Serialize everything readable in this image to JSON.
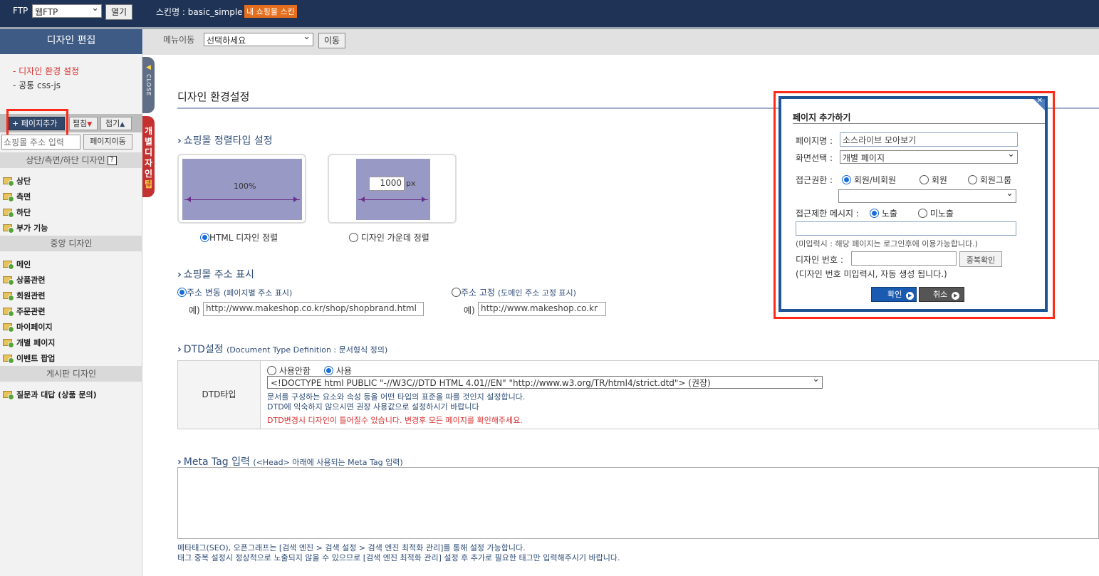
{
  "topbar": {
    "ftp_label": "FTP",
    "ftp_select": "웹FTP",
    "open_button": "열기",
    "skin_label": "스킨명 : basic_simple",
    "my_skin_badge": "내 쇼핑몰 스킨"
  },
  "sidebar": {
    "title": "디자인 편집",
    "links": [
      {
        "label": "- 디자인 환경 설정",
        "active": true
      },
      {
        "label": "- 공통 css-js",
        "active": false
      }
    ],
    "add_page": "+ 페이지추가",
    "expand": "펼침",
    "collapse": "접기",
    "search_placeholder": "쇼핑몰 주소 입력",
    "move_page": "페이지이동",
    "sections": [
      {
        "title": "상단/측면/하단 디자인",
        "help": "?",
        "items": [
          "상단",
          "측면",
          "하단",
          "부가 기능"
        ]
      },
      {
        "title": "중앙 디자인",
        "items": [
          "메인",
          "상품관련",
          "회원관련",
          "주문관련",
          "마이페이지",
          "개별 페이지",
          "이벤트 팝업"
        ]
      },
      {
        "title": "게시판 디자인",
        "items": [
          "질문과 대답 (상품 문의)"
        ]
      }
    ],
    "close_tab": "CLOSE",
    "tip_tab": [
      "개",
      "별",
      "디",
      "자",
      "인"
    ],
    "tip_tab_last": "팁"
  },
  "menubar": {
    "label": "메뉴이동",
    "select": "선택하세요",
    "go_button": "이동"
  },
  "main": {
    "title": "디자인 환경설정",
    "align": {
      "heading": "쇼핑몰 정렬타입 설정",
      "opt1_box": "100%",
      "opt2_value": "1000",
      "opt2_unit": "px",
      "opt1_label": "HTML 디자인 정렬",
      "opt2_label": "디자인 가운데 정렬",
      "selected": 1
    },
    "address": {
      "heading": "쇼핑몰 주소 표시",
      "opt1_label": "주소 변동",
      "opt1_desc": "(페이지별 주소 표시)",
      "opt1_example_label": "예)",
      "opt1_example": "http://www.makeshop.co.kr/shop/shopbrand.html",
      "opt2_label": "주소 고정",
      "opt2_desc": "(도메인 주소 고정 표시)",
      "opt2_example_label": "예)",
      "opt2_example": "http://www.makeshop.co.kr",
      "selected": 1
    },
    "dtd": {
      "heading": "DTD설정",
      "heading_small": "(Document Type Definition : 문서형식 정의)",
      "row_label": "DTD타입",
      "opt_off": "사용안함",
      "opt_on": "사용",
      "selected": "on",
      "select_value": "<!DOCTYPE html PUBLIC \"-//W3C//DTD HTML 4.01//EN\" \"http://www.w3.org/TR/html4/strict.dtd\"> (권장)",
      "desc1": "문서를 구성하는 요소와 속성 등을 어떤 타입의 표준을 따를 것인지 설정합니다.",
      "desc2": "DTD에 익숙하지 않으시면 권장 사용값으로 설정하시기 바랍니다",
      "warning": "DTD변경시 디자인이 틀어질수 있습니다. 변경후 모든 페이지를 확인해주세요."
    },
    "meta": {
      "heading": "Meta Tag 입력",
      "heading_small": "(<Head> 아래에 사용되는 Meta Tag 입력)",
      "note1": "메타태그(SEO), 오픈그래프는 [검색 엔진 > 검색 설정 > 검색 엔진 최적화 관리]를 통해 설정 가능합니다.",
      "note2": "태그 중복 설정시 정상적으로 노출되지 않을 수 있으므로 [검색 엔진 최적화 관리] 설정 후 추가로 필요한 태그만 입력해주시기 바랍니다."
    }
  },
  "modal": {
    "title": "페이지 추가하기",
    "page_name_label": "페이지명 :",
    "page_name_value": "소스라이브 모아보기",
    "screen_label": "화면선택 :",
    "screen_value": "개별 페이지",
    "access_label": "접근권한 :",
    "access_opts": [
      "회원/비회원",
      "회원",
      "회원그룹"
    ],
    "access_selected": 0,
    "group_select": "",
    "restrict_label": "접근제한 메시지 :",
    "restrict_opts": [
      "노출",
      "미노출"
    ],
    "restrict_selected": 0,
    "restrict_value": "",
    "restrict_note": "(미입력시 : 해당 페이지는 로그인후에 이용가능합니다.)",
    "design_no_label": "디자인 번호 :",
    "design_no_value": "",
    "dup_check": "중복확인",
    "design_no_note": "(디자인 번호 미입력시, 자동 생성 됩니다.)",
    "ok": "확인",
    "cancel": "취소"
  },
  "colors": {
    "topbar": "#1f3356",
    "highlight": "#ff2a17",
    "accent_blue": "#1a5ab0"
  }
}
